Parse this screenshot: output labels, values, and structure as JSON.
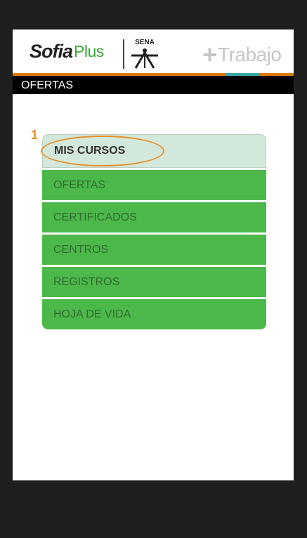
{
  "header": {
    "logo_main": "Sofia",
    "logo_plus": "Plus",
    "partner_logo_text": "SENA",
    "trabajo_plus": "+",
    "trabajo_text": "Trabajo"
  },
  "page_title": "OFERTAS",
  "menu": {
    "items": [
      {
        "label": "MIS CURSOS",
        "selected": true
      },
      {
        "label": "OFERTAS"
      },
      {
        "label": "CERTIFICADOS"
      },
      {
        "label": "CENTROS"
      },
      {
        "label": "REGISTROS"
      },
      {
        "label": "HOJA DE VIDA"
      }
    ]
  },
  "annotation": {
    "number": "1"
  },
  "colors": {
    "accent_orange": "#e07b14",
    "menu_green": "#4db84a",
    "menu_selected": "#d2e8da",
    "callout": "#e8902a"
  }
}
